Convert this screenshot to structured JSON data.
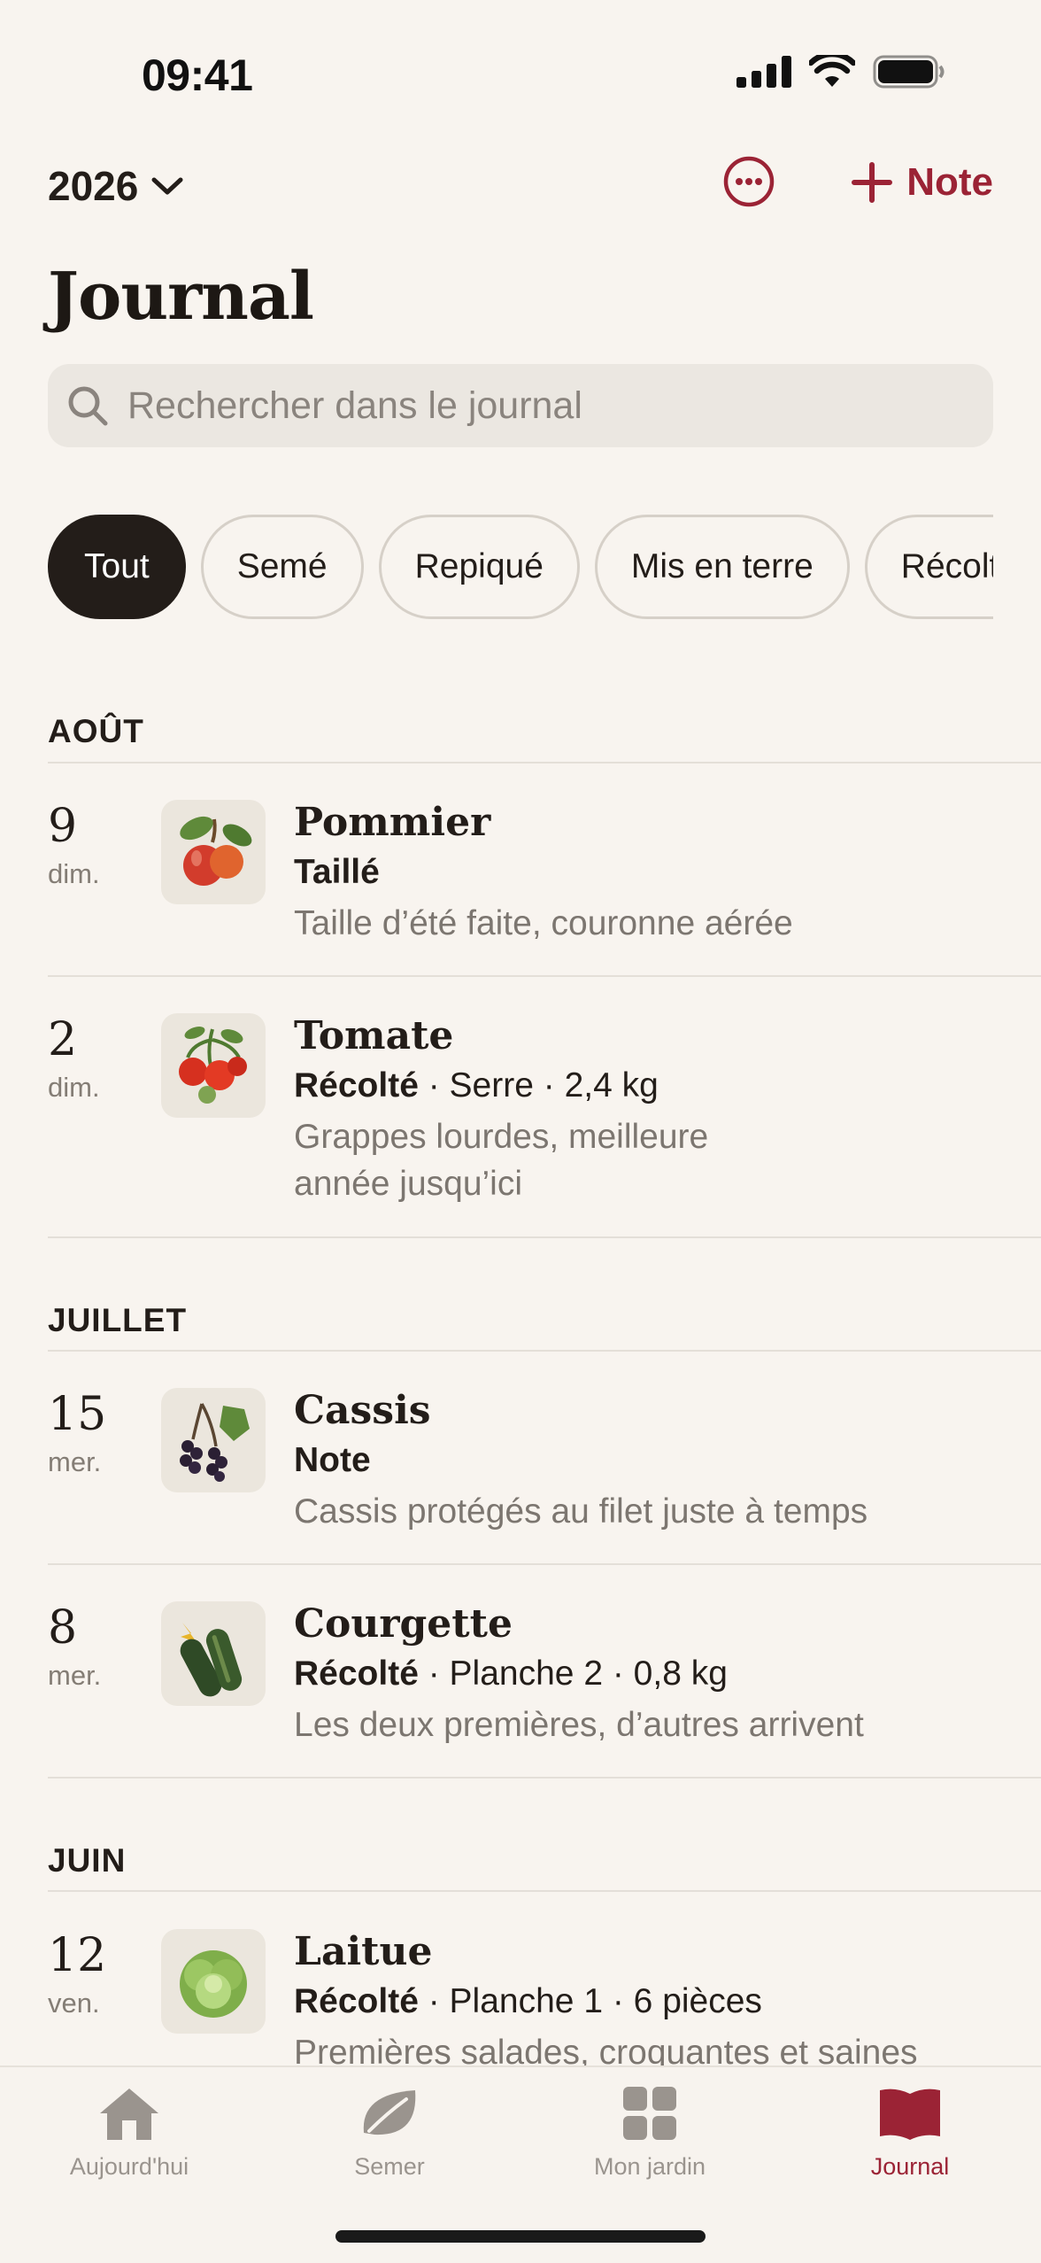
{
  "status_bar": {
    "time": "09:41"
  },
  "header": {
    "year": "2026",
    "add_note_label": "Note",
    "title": "Journal"
  },
  "search": {
    "placeholder": "Rechercher dans le journal"
  },
  "filters": [
    {
      "label": "Tout",
      "active": true
    },
    {
      "label": "Semé"
    },
    {
      "label": "Repiqué"
    },
    {
      "label": "Mis en terre"
    },
    {
      "label": "Récolté"
    }
  ],
  "sections": [
    {
      "month": "AOÛT",
      "entries": [
        {
          "day": "9",
          "weekday": "dim.",
          "plant": "Pommier",
          "icon": "apple-illustration",
          "action": "Taillé",
          "details": "",
          "note": "Taille d’été faite, couronne aérée"
        },
        {
          "day": "2",
          "weekday": "dim.",
          "plant": "Tomate",
          "icon": "tomato-illustration",
          "action": "Récolté",
          "details": " · Serre · 2,4 kg",
          "note": "Grappes lourdes, meilleure année jusqu’ici"
        }
      ]
    },
    {
      "month": "JUILLET",
      "entries": [
        {
          "day": "15",
          "weekday": "mer.",
          "plant": "Cassis",
          "icon": "blackcurrant-illustration",
          "action": "Note",
          "details": "",
          "note": "Cassis protégés au filet juste à temps"
        },
        {
          "day": "8",
          "weekday": "mer.",
          "plant": "Courgette",
          "icon": "zucchini-illustration",
          "action": "Récolté",
          "details": " · Planche 2 · 0,8 kg",
          "note": "Les deux premières, d’autres arrivent"
        }
      ]
    },
    {
      "month": "JUIN",
      "entries": [
        {
          "day": "12",
          "weekday": "ven.",
          "plant": "Laitue",
          "icon": "lettuce-illustration",
          "action": "Récolté",
          "details": " · Planche 1 · 6 pièces",
          "note": "Premières salades, croquantes et saines"
        }
      ]
    }
  ],
  "tabs": [
    {
      "label": "Aujourd'hui",
      "icon": "home-icon"
    },
    {
      "label": "Semer",
      "icon": "leaf-icon"
    },
    {
      "label": "Mon jardin",
      "icon": "grid-icon"
    },
    {
      "label": "Journal",
      "icon": "book-icon",
      "active": true
    }
  ],
  "colors": {
    "accent": "#9b2335",
    "background": "#f8f4ef",
    "active_chip": "#231d19",
    "inactive_tab": "#9a948e"
  }
}
